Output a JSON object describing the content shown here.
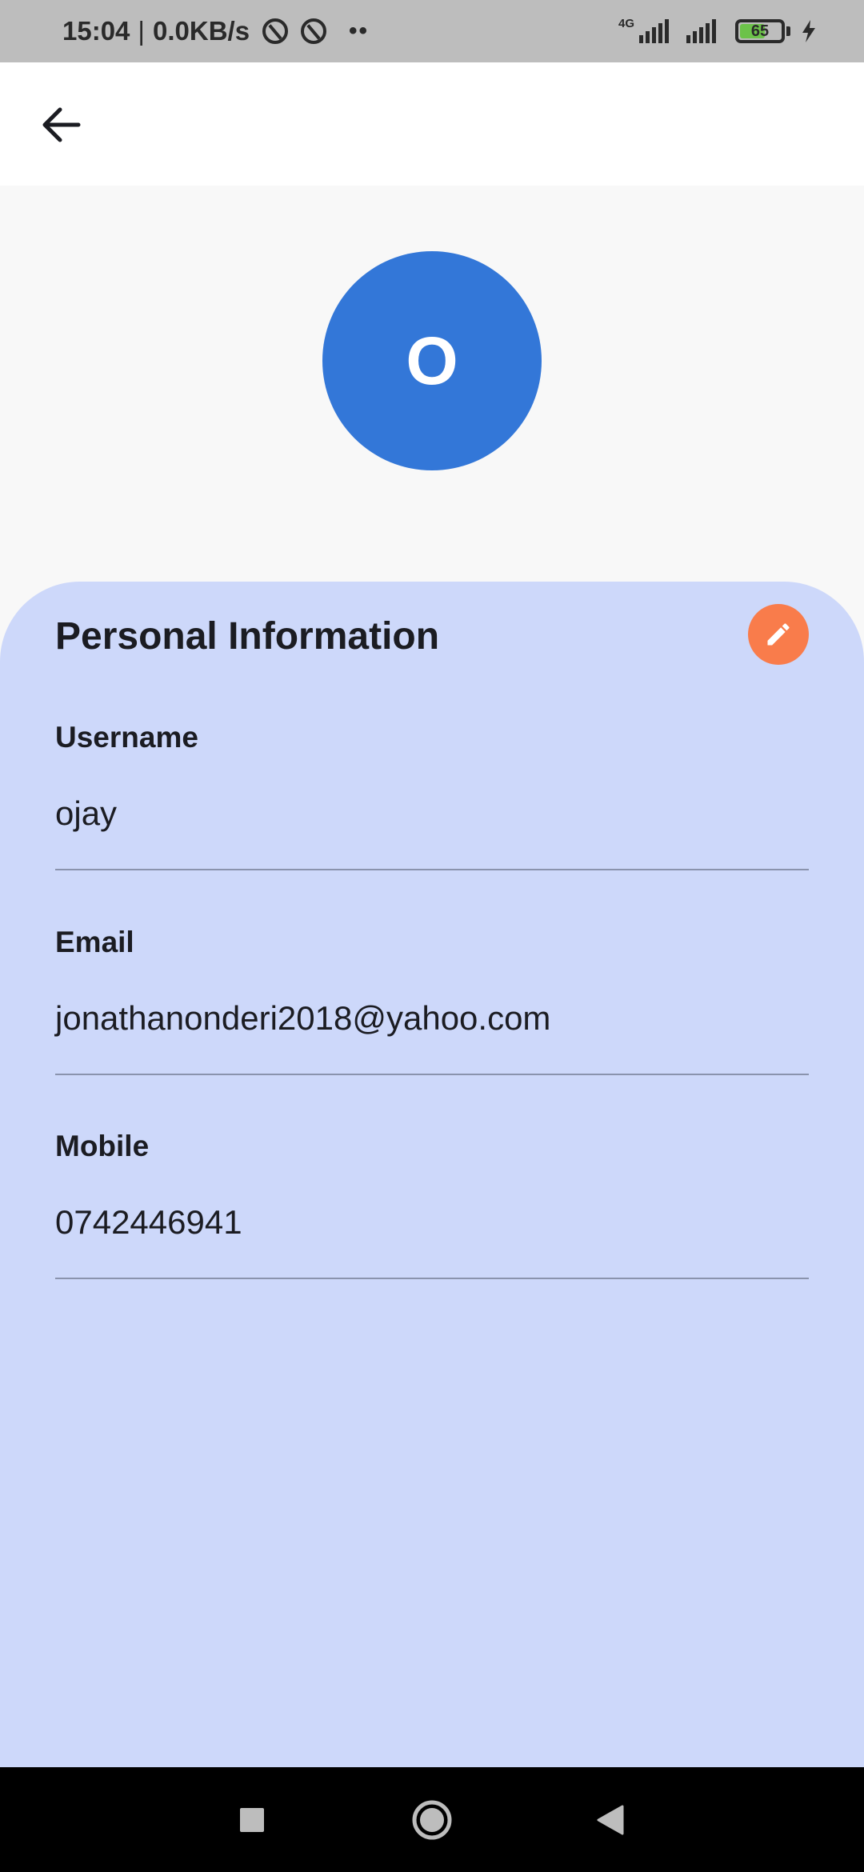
{
  "status_bar": {
    "time": "15:04",
    "separator": "|",
    "net_speed": "0.0KB/s",
    "dots": "••",
    "network_type": "4G",
    "battery_level": "65",
    "icons": [
      "data-saver-icon",
      "data-saver-icon",
      "signal-icon",
      "signal-icon",
      "battery-icon",
      "charging-bolt-icon"
    ]
  },
  "app_bar": {
    "back_icon": "arrow-back-icon"
  },
  "avatar": {
    "initial": "O",
    "color": "#3377d8"
  },
  "personal_info": {
    "title": "Personal Information",
    "edit_icon": "pencil-icon",
    "edit_color": "#f97c4b",
    "card_color": "#cdd8fa",
    "fields": [
      {
        "label": "Username",
        "value": "ojay"
      },
      {
        "label": "Email",
        "value": "jonathanonderi2018@yahoo.com"
      },
      {
        "label": "Mobile",
        "value": "0742446941"
      }
    ]
  },
  "nav_bar": {
    "buttons": [
      "recents-icon",
      "home-icon",
      "back-triangle-icon"
    ]
  }
}
